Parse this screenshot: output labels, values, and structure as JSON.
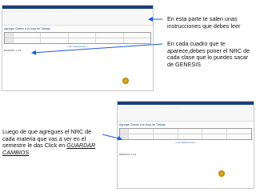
{
  "callouts": {
    "top": "En esta parte te salen unas instrucciones que debes leer",
    "middle": "En cada cuadro que te aparece,debes poner el NRC de cada clase que lo puedes sacar de GENESIS",
    "bottom_prefix": "Luego de que agregues el NRC de cada materia que vas a ver en el semestre le das Click en",
    "bottom_emphasis": "GUARDAR CAMBIOS"
  },
  "screenshots": [
    {
      "title": "Agregar Clases a la Hoja de Trabajo",
      "link": "[ Ver Selecciones ]",
      "footer": "RANSON: 7.3.3"
    },
    {
      "title": "Agregar Clases a la Hoja de Trabajo",
      "link": "[ Ver Selecciones ]",
      "footer": "RANSON: 7.3.3"
    }
  ],
  "colors": {
    "accent": "#1d3f7a",
    "arrow": "#1d5ad6"
  }
}
